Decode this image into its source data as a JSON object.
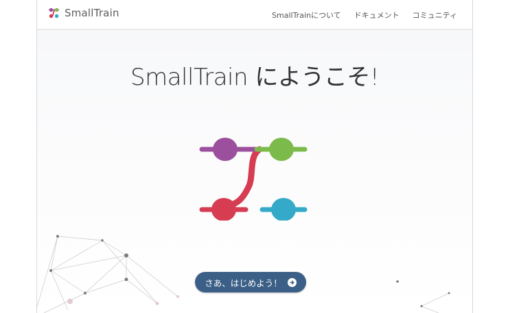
{
  "navbar": {
    "brand": "SmallTrain",
    "links": [
      "SmallTrainについて",
      "ドキュメント",
      "コミュニティ"
    ]
  },
  "hero": {
    "title": "SmallTrain にようこそ!",
    "cta_label": "さあ、はじめよう！",
    "cta_icon": "arrow-circle-right-icon"
  },
  "colors": {
    "purple": "#9b4f9d",
    "green": "#7cbb4b",
    "red": "#d63c52",
    "cyan": "#35aac8",
    "button": "#3b5f86"
  }
}
